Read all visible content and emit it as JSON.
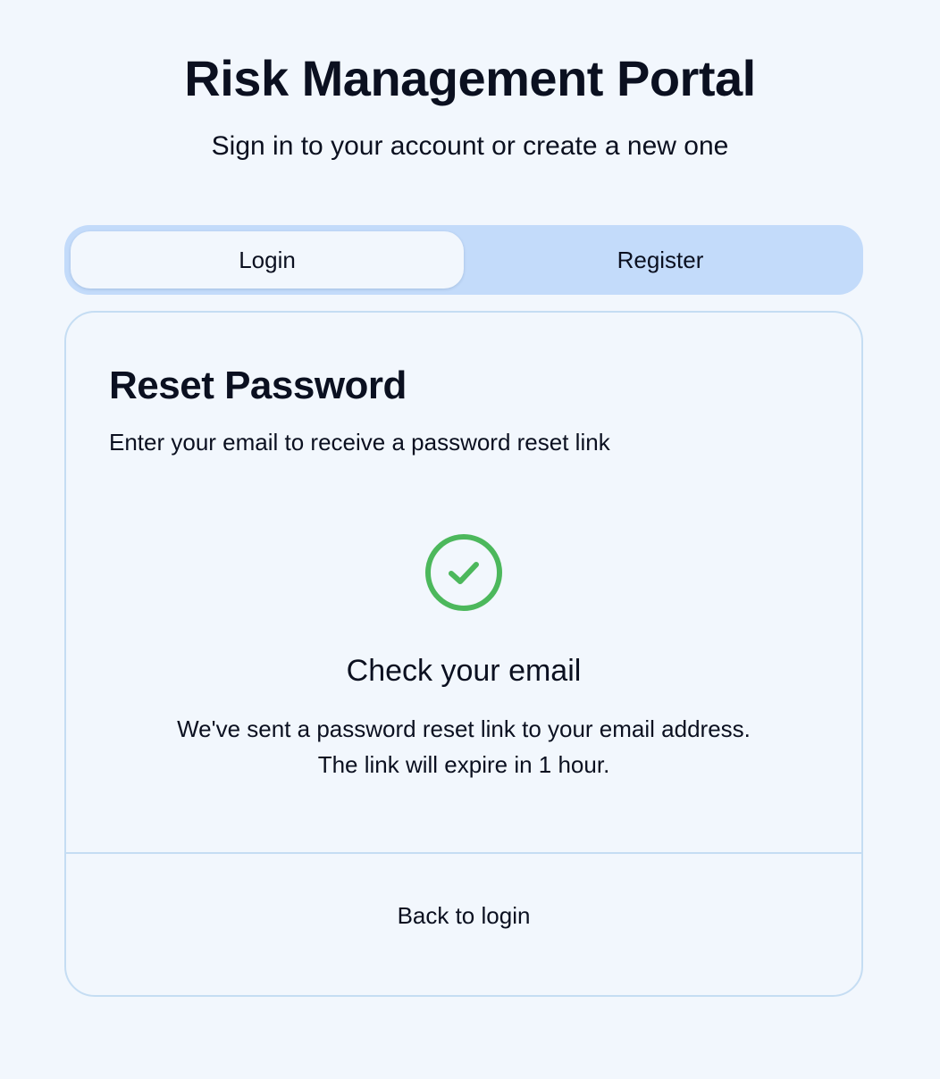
{
  "header": {
    "title": "Risk Management Portal",
    "subtitle": "Sign in to your account or create a new one"
  },
  "tabs": [
    {
      "label": "Login",
      "active": true
    },
    {
      "label": "Register",
      "active": false
    }
  ],
  "card": {
    "title": "Reset Password",
    "description": "Enter your email to receive a password reset link",
    "success": {
      "icon": "check-circle-icon",
      "icon_color": "#4cb85c",
      "title": "Check your email",
      "lines": [
        "We've sent a password reset link to your email address.",
        "The link will expire in 1 hour."
      ]
    },
    "back_label": "Back to login"
  },
  "colors": {
    "background": "#f2f7fd",
    "tab_track": "#c3dbfa",
    "border": "#c5ddf3",
    "text": "#0b1020",
    "success": "#4cb85c"
  }
}
